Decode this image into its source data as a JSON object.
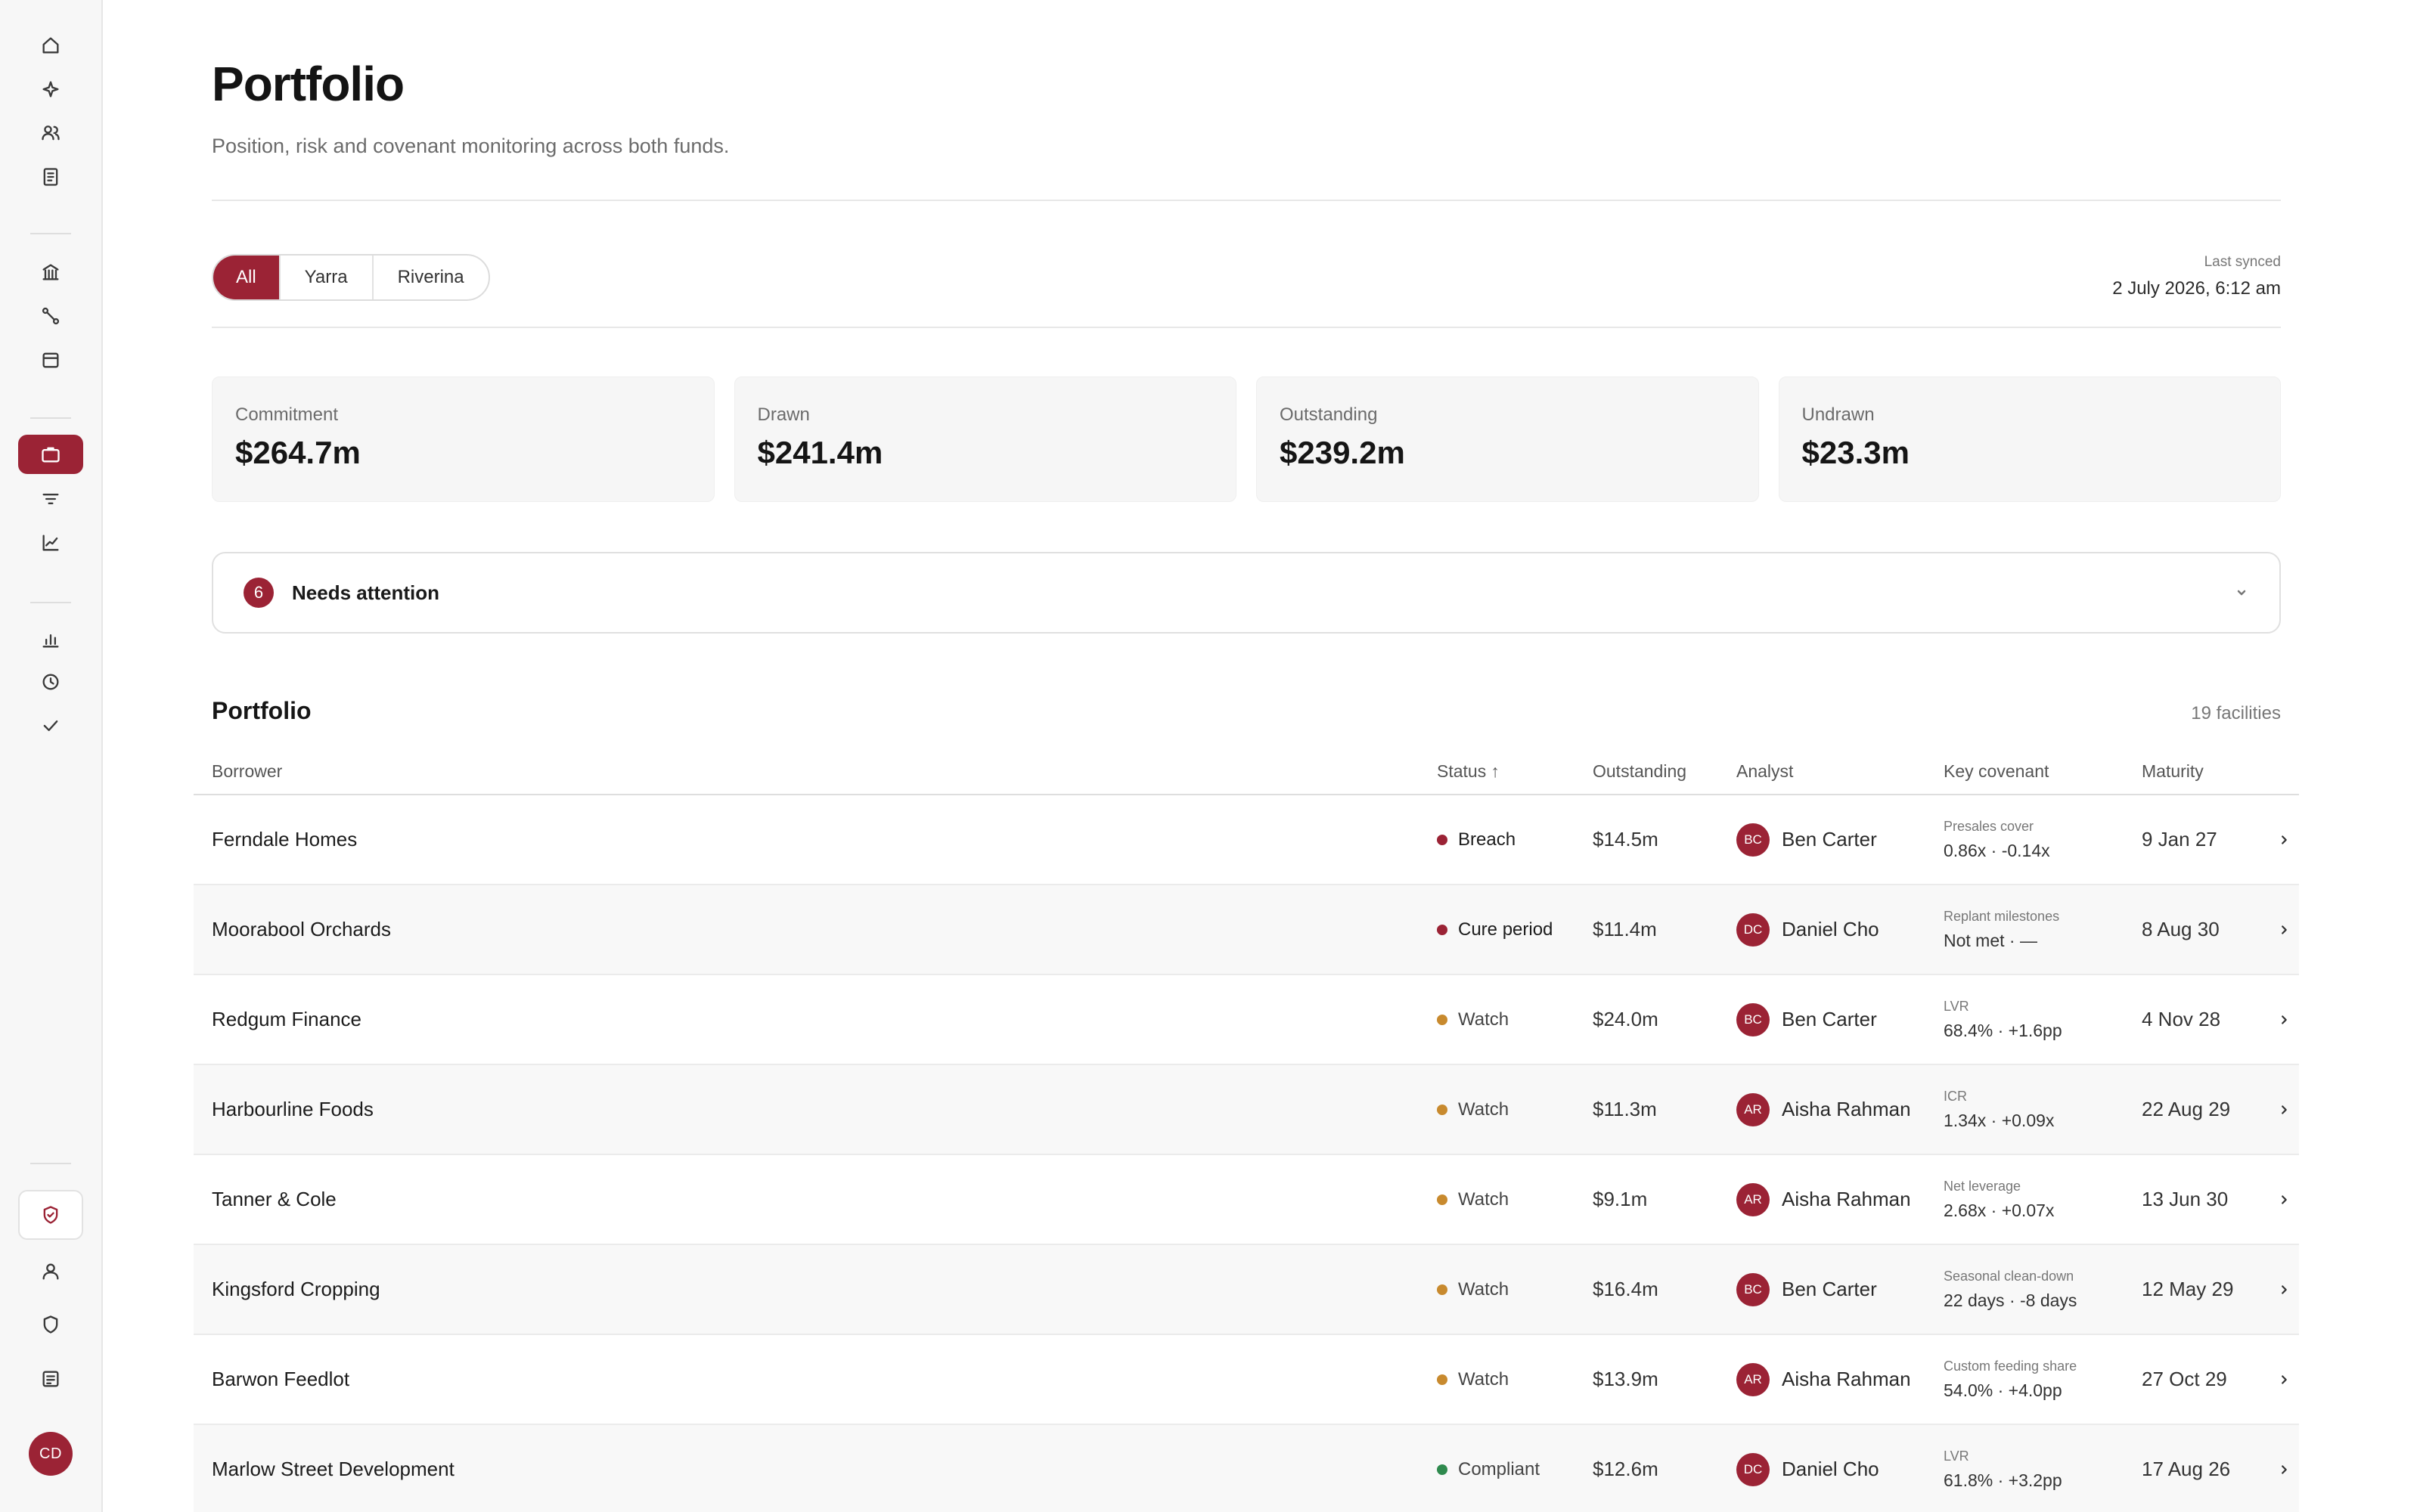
{
  "sidebar": {
    "icons": [
      "home-icon",
      "sparkle-icon",
      "users-icon",
      "document-icon",
      "bank-icon",
      "route-icon",
      "calendar-icon",
      "briefcase-icon",
      "filter-icon",
      "line-chart-icon",
      "bar-chart-icon",
      "clock-icon",
      "check-icon",
      "shield-check-icon",
      "user-icon",
      "shield-icon",
      "notes-icon"
    ],
    "active": "briefcase-icon",
    "avatar_initials": "CD"
  },
  "header": {
    "title": "Portfolio",
    "subtitle": "Position, risk and covenant monitoring across both funds."
  },
  "filters": {
    "options": [
      "All",
      "Yarra",
      "Riverina"
    ],
    "selected": "All"
  },
  "sync": {
    "label": "Last synced",
    "value": "2 July 2026, 6:12 am"
  },
  "metrics": [
    {
      "label": "Commitment",
      "value": "$264.7m"
    },
    {
      "label": "Drawn",
      "value": "$241.4m"
    },
    {
      "label": "Outstanding",
      "value": "$239.2m"
    },
    {
      "label": "Undrawn",
      "value": "$23.3m"
    }
  ],
  "attention": {
    "count": "6",
    "label": "Needs attention"
  },
  "table": {
    "title": "Portfolio",
    "count": "19 facilities",
    "columns": {
      "borrower": "Borrower",
      "status": "Status",
      "status_sort": "↑",
      "outstanding": "Outstanding",
      "analyst": "Analyst",
      "covenant": "Key covenant",
      "maturity": "Maturity"
    },
    "rows": [
      {
        "borrower": "Ferndale Homes",
        "status": "Breach",
        "status_color": "#9b2335",
        "outstanding": "$14.5m",
        "analyst_initials": "BC",
        "analyst": "Ben Carter",
        "covenant_name": "Presales cover",
        "covenant_value": "0.86x · -0.14x",
        "maturity": "9 Jan 27"
      },
      {
        "borrower": "Moorabool Orchards",
        "status": "Cure period",
        "status_color": "#9b2335",
        "outstanding": "$11.4m",
        "analyst_initials": "DC",
        "analyst": "Daniel Cho",
        "covenant_name": "Replant milestones",
        "covenant_value": "Not met · —",
        "maturity": "8 Aug 30"
      },
      {
        "borrower": "Redgum Finance",
        "status": "Watch",
        "status_color": "#c88a2e",
        "outstanding": "$24.0m",
        "analyst_initials": "BC",
        "analyst": "Ben Carter",
        "covenant_name": "LVR",
        "covenant_value": "68.4% · +1.6pp",
        "maturity": "4 Nov 28"
      },
      {
        "borrower": "Harbourline Foods",
        "status": "Watch",
        "status_color": "#c88a2e",
        "outstanding": "$11.3m",
        "analyst_initials": "AR",
        "analyst": "Aisha Rahman",
        "covenant_name": "ICR",
        "covenant_value": "1.34x · +0.09x",
        "maturity": "22 Aug 29"
      },
      {
        "borrower": "Tanner & Cole",
        "status": "Watch",
        "status_color": "#c88a2e",
        "outstanding": "$9.1m",
        "analyst_initials": "AR",
        "analyst": "Aisha Rahman",
        "covenant_name": "Net leverage",
        "covenant_value": "2.68x · +0.07x",
        "maturity": "13 Jun 30"
      },
      {
        "borrower": "Kingsford Cropping",
        "status": "Watch",
        "status_color": "#c88a2e",
        "outstanding": "$16.4m",
        "analyst_initials": "BC",
        "analyst": "Ben Carter",
        "covenant_name": "Seasonal clean-down",
        "covenant_value": "22 days · -8 days",
        "maturity": "12 May 29"
      },
      {
        "borrower": "Barwon Feedlot",
        "status": "Watch",
        "status_color": "#c88a2e",
        "outstanding": "$13.9m",
        "analyst_initials": "AR",
        "analyst": "Aisha Rahman",
        "covenant_name": "Custom feeding share",
        "covenant_value": "54.0% · +4.0pp",
        "maturity": "27 Oct 29"
      },
      {
        "borrower": "Marlow Street Development",
        "status": "Compliant",
        "status_color": "#2f8a4e",
        "outstanding": "$12.6m",
        "analyst_initials": "DC",
        "analyst": "Daniel Cho",
        "covenant_name": "LVR",
        "covenant_value": "61.8% · +3.2pp",
        "maturity": "17 Aug 26"
      }
    ]
  },
  "colors": {
    "accent": "#9b2335",
    "watch": "#c88a2e",
    "compliant": "#2f8a4e"
  }
}
